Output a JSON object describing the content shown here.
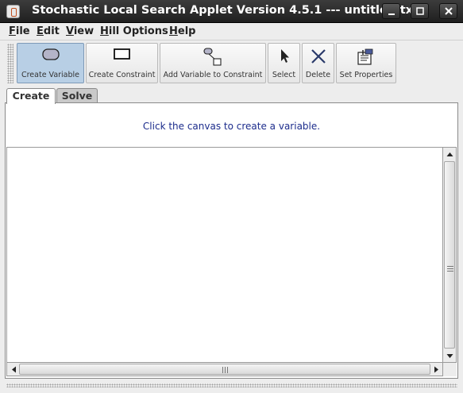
{
  "window": {
    "title": "Stochastic Local Search Applet Version 4.5.1 --- untitled.txt",
    "app_icon": "java-cup-icon",
    "controls": [
      {
        "name": "minimize",
        "icon": "minimize-icon"
      },
      {
        "name": "maximize",
        "icon": "maximize-icon"
      },
      {
        "name": "close",
        "icon": "close-icon"
      }
    ]
  },
  "menu": {
    "items": [
      {
        "label": "File",
        "mnemonic": "F",
        "rest": "ile"
      },
      {
        "label": "Edit",
        "mnemonic": "E",
        "rest": "dit"
      },
      {
        "label": "View",
        "mnemonic": "V",
        "rest": "iew"
      },
      {
        "label": "Hill Options",
        "mnemonic": "H",
        "rest": "ill Options"
      },
      {
        "label": "Help",
        "mnemonic": "H",
        "rest": "elp"
      }
    ]
  },
  "toolbar": {
    "buttons": [
      {
        "label": "Create Variable",
        "icon": "ellipse-icon",
        "selected": true
      },
      {
        "label": "Create Constraint",
        "icon": "rectangle-icon",
        "selected": false
      },
      {
        "label": "Add Variable to Constraint",
        "icon": "connect-icon",
        "selected": false
      },
      {
        "label": "Select",
        "icon": "pointer-icon",
        "selected": false
      },
      {
        "label": "Delete",
        "icon": "delete-x-icon",
        "selected": false
      },
      {
        "label": "Set Properties",
        "icon": "properties-icon",
        "selected": false
      }
    ]
  },
  "tabs": [
    {
      "label": "Create",
      "active": true
    },
    {
      "label": "Solve",
      "active": false
    }
  ],
  "content": {
    "message": "Click the canvas to create a variable."
  },
  "colors": {
    "titlebar": "#2a2a2a",
    "selected_button": "#b8cfe5",
    "message_text": "#1c2c8c"
  }
}
